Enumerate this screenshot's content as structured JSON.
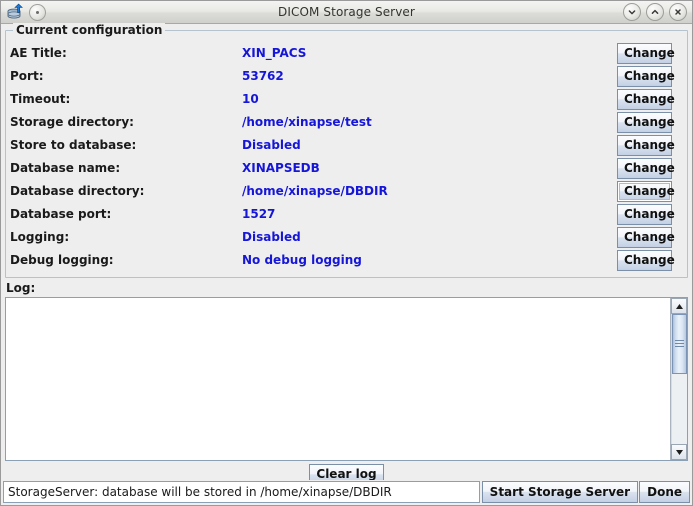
{
  "window": {
    "title": "DICOM Storage Server",
    "icon": "database-upload-icon",
    "menu_button": "window-menu-button",
    "controls": [
      {
        "name": "minimize-button",
        "glyph": "chevron-down"
      },
      {
        "name": "maximize-button",
        "glyph": "chevron-up"
      },
      {
        "name": "close-button",
        "glyph": "x"
      }
    ]
  },
  "config": {
    "group_title": "Current configuration",
    "change_label": "Change",
    "focused_row_index": 6,
    "rows": [
      {
        "label": "AE Title:",
        "value": "XIN_PACS"
      },
      {
        "label": "Port:",
        "value": "53762"
      },
      {
        "label": "Timeout:",
        "value": "10"
      },
      {
        "label": "Storage directory:",
        "value": "/home/xinapse/test"
      },
      {
        "label": "Store to database:",
        "value": "Disabled"
      },
      {
        "label": "Database name:",
        "value": "XINAPSEDB"
      },
      {
        "label": "Database directory:",
        "value": "/home/xinapse/DBDIR"
      },
      {
        "label": "Database port:",
        "value": "1527"
      },
      {
        "label": "Logging:",
        "value": "Disabled"
      },
      {
        "label": "Debug logging:",
        "value": "No debug logging"
      }
    ]
  },
  "log": {
    "label": "Log:",
    "content": "",
    "clear_label": "Clear log",
    "scrollbar": {
      "up_arrow": "scroll-up-arrow",
      "down_arrow": "scroll-down-arrow",
      "thumb_position_percent": 0,
      "thumb_size_percent": 46
    }
  },
  "status": {
    "message": "StorageServer: database will be stored in /home/xinapse/DBDIR",
    "start_label": "Start Storage Server",
    "done_label": "Done"
  },
  "colors": {
    "value_text": "#1616d8",
    "label_text": "#1a1a1a",
    "panel_bg": "#eeeeee",
    "group_border": "#b5c3cf",
    "button_border": "#7b8fa8"
  }
}
